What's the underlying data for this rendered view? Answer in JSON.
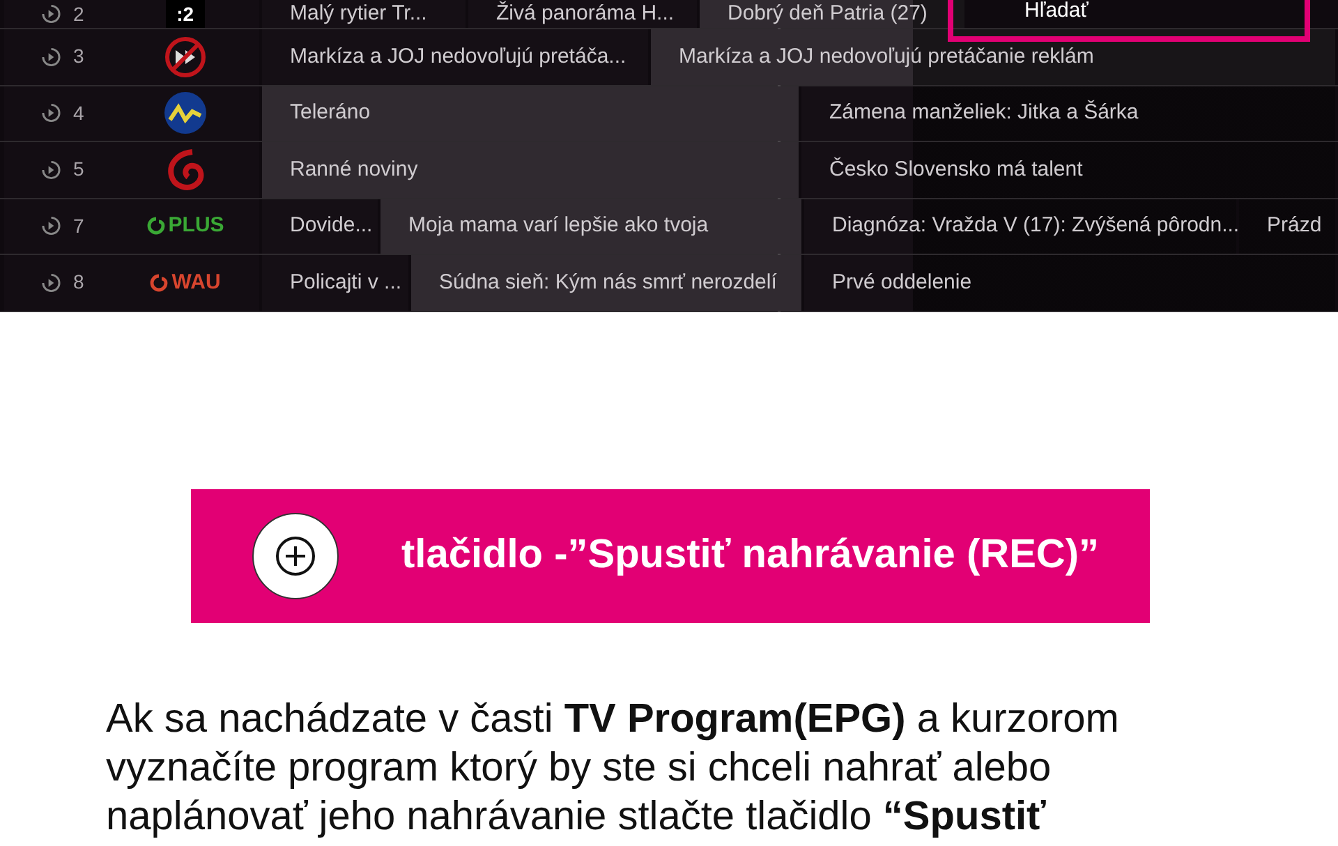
{
  "epg": {
    "search_label": "Hľadať",
    "rows": [
      {
        "number": "2",
        "logo": {
          "kind": "text",
          "text": ":2"
        },
        "programs": [
          {
            "title": "Malý rytier Tr...",
            "current": false
          },
          {
            "title": "Živá panoráma H...",
            "current": false
          },
          {
            "title": "Dobrý deň Patria (27)",
            "current": true
          }
        ]
      },
      {
        "number": "3",
        "logo": {
          "kind": "noskip"
        },
        "programs": [
          {
            "title": "Markíza a JOJ nedovoľujú pretáča...",
            "current": false
          },
          {
            "title": "Markíza a JOJ nedovoľujú pretáčanie reklám",
            "current": true
          }
        ]
      },
      {
        "number": "4",
        "logo": {
          "kind": "wave"
        },
        "programs": [
          {
            "title": "Teleráno",
            "current": true
          },
          {
            "title": "Zámena manželiek: Jitka a Šárka",
            "current": false
          }
        ]
      },
      {
        "number": "5",
        "logo": {
          "kind": "spiral"
        },
        "programs": [
          {
            "title": "Ranné noviny",
            "current": true
          },
          {
            "title": "Česko Slovensko má talent",
            "current": false
          }
        ]
      },
      {
        "number": "7",
        "logo": {
          "kind": "swirl-text",
          "text": "PLUS",
          "color": "#3aa835"
        },
        "programs": [
          {
            "title": "Dovide...",
            "current": false
          },
          {
            "title": "Moja mama varí lepšie ako tvoja",
            "current": true
          },
          {
            "title": "Diagnóza: Vražda V (17): Zvýšená pôrodn...",
            "current": false
          },
          {
            "title": "Prázd",
            "current": false
          }
        ]
      },
      {
        "number": "8",
        "logo": {
          "kind": "swirl-text",
          "text": "WAU",
          "color": "#d8452e"
        },
        "programs": [
          {
            "title": "Policajti v ...",
            "current": false
          },
          {
            "title": "Súdna sieň: Kým nás smrť nerozdelí",
            "current": true
          },
          {
            "title": "Prvé oddelenie",
            "current": false
          }
        ]
      }
    ]
  },
  "banner": {
    "text": "tlačidlo -”Spustiť nahrávanie (REC)”"
  },
  "paragraph": "Ak sa  nachádzate v časti **TV Program(EPG)** a kurzorom vyznačíte program ktorý by ste si chceli nahrať alebo naplánovať jeho nahrávanie stlačte tlačidlo **“Spustiť**"
}
